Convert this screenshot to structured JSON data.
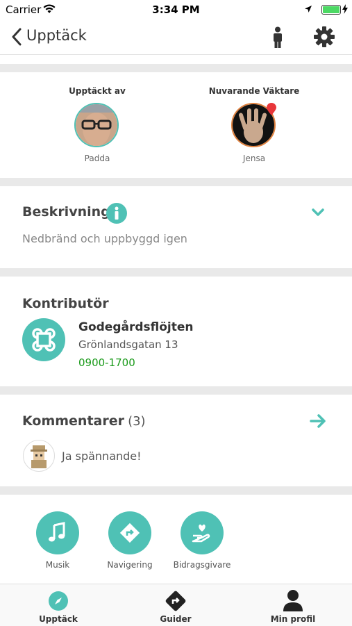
{
  "status_bar": {
    "carrier": "Carrier",
    "time": "3:34 PM"
  },
  "nav": {
    "back_label": "Upptäck",
    "icons": [
      "chevron-left-icon",
      "person-icon",
      "gear-icon"
    ]
  },
  "discovery": {
    "discovered_by": {
      "caption": "Upptäckt av",
      "name": "Padda"
    },
    "guardian": {
      "caption": "Nuvarande Väktare",
      "name": "Jensa"
    }
  },
  "description": {
    "title": "Beskrivning",
    "text": "Nedbränd och uppbyggd igen"
  },
  "contributor": {
    "title": "Kontributör",
    "name": "Godegårdsflöjten",
    "address": "Grönlandsgatan 13",
    "hours": "0900-1700",
    "hours_color": "#1a9a1a"
  },
  "comments": {
    "title": "Kommentarer",
    "count": "(3)",
    "first_comment": "Ja spännande!"
  },
  "actions": [
    {
      "label": "Musik",
      "icon": "music-note-icon"
    },
    {
      "label": "Navigering",
      "icon": "navigation-icon"
    },
    {
      "label": "Bidragsgivare",
      "icon": "donor-hand-icon"
    }
  ],
  "tabbar": [
    {
      "label": "Upptäck",
      "icon": "compass-icon"
    },
    {
      "label": "Guider",
      "icon": "directions-icon"
    },
    {
      "label": "Min profil",
      "icon": "profile-icon"
    }
  ],
  "accent_color": "#4fc1b5"
}
